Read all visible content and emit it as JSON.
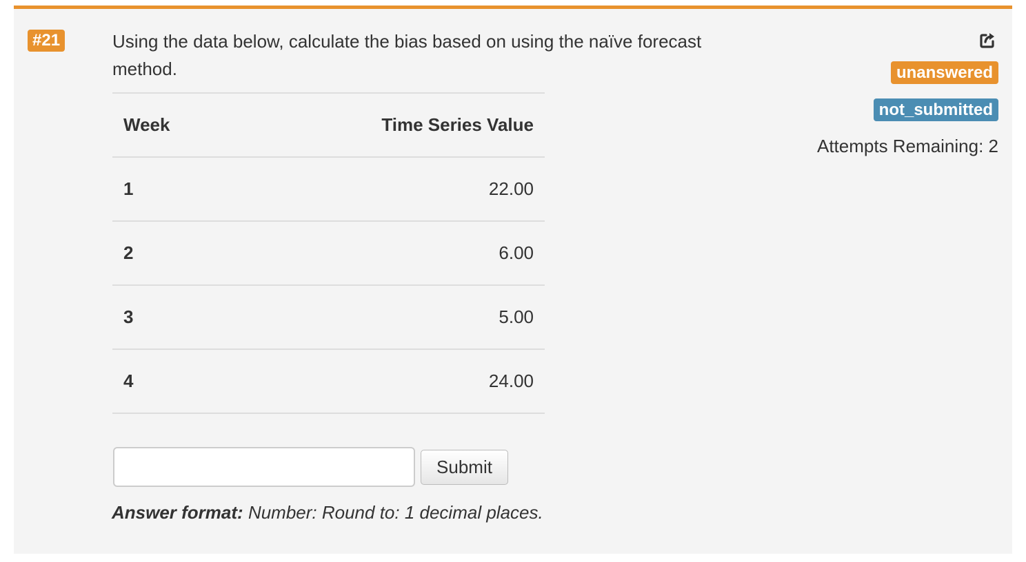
{
  "question": {
    "number": "#21",
    "text": "Using the data below, calculate the bias based on using the naïve forecast method."
  },
  "table": {
    "headers": [
      "Week",
      "Time Series Value"
    ],
    "rows": [
      {
        "week": "1",
        "value": "22.00"
      },
      {
        "week": "2",
        "value": "6.00"
      },
      {
        "week": "3",
        "value": "5.00"
      },
      {
        "week": "4",
        "value": "24.00"
      }
    ]
  },
  "answer": {
    "input_value": "",
    "submit_label": "Submit",
    "format_label": "Answer format:",
    "format_text": "Number: Round to: 1 decimal places."
  },
  "status": {
    "icon": "share-icon",
    "badge_answer": "unanswered",
    "badge_submission": "not_submitted",
    "attempts": "Attempts Remaining: 2"
  },
  "colors": {
    "accent_orange": "#e8922e",
    "badge_blue": "#4b8db3",
    "panel_bg": "#f4f4f4"
  }
}
